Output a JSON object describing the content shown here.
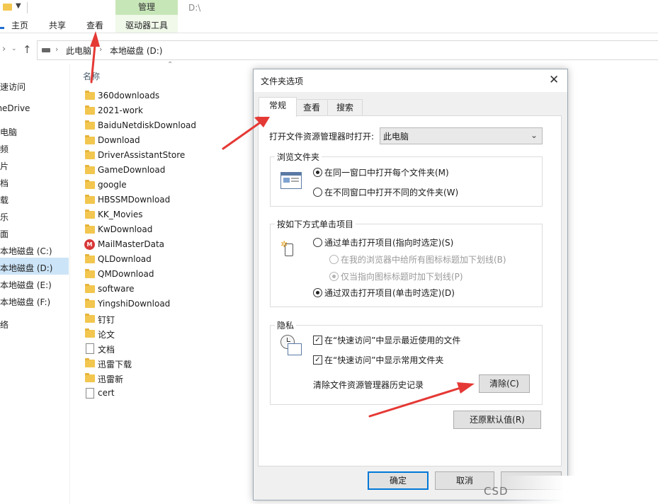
{
  "ribbon": {
    "manage_tab": "管理",
    "window_title": "D:\\",
    "tabs": [
      {
        "label": "主页"
      },
      {
        "label": "共享"
      },
      {
        "label": "查看"
      },
      {
        "label": "驱动器工具"
      }
    ]
  },
  "address": {
    "crumbs": [
      "此电脑",
      "本地磁盘 (D:)"
    ]
  },
  "nav_pane": {
    "items": [
      {
        "label": "快速访问"
      },
      {
        "label": "OneDrive"
      },
      {
        "label": "此电脑"
      },
      {
        "label": "视频"
      },
      {
        "label": "图片"
      },
      {
        "label": "文档"
      },
      {
        "label": "下载"
      },
      {
        "label": "音乐"
      },
      {
        "label": "桌面"
      },
      {
        "label": "本地磁盘 (C:)"
      },
      {
        "label": "本地磁盘 (D:)"
      },
      {
        "label": "本地磁盘 (E:)"
      },
      {
        "label": "本地磁盘 (F:)"
      },
      {
        "label": "网络"
      }
    ]
  },
  "file_list": {
    "column_name": "名称",
    "files": [
      {
        "name": "360downloads",
        "icon": "folder-icon"
      },
      {
        "name": "2021-work",
        "icon": "folder-icon"
      },
      {
        "name": "BaiduNetdiskDownload",
        "icon": "folder-icon"
      },
      {
        "name": "Download",
        "icon": "folder-icon"
      },
      {
        "name": "DriverAssistantStore",
        "icon": "folder-icon"
      },
      {
        "name": "GameDownload",
        "icon": "folder-icon"
      },
      {
        "name": "google",
        "icon": "folder-icon"
      },
      {
        "name": "HBSSMDownload",
        "icon": "folder-icon"
      },
      {
        "name": "KK_Movies",
        "icon": "folder-icon"
      },
      {
        "name": "KwDownload",
        "icon": "folder-icon"
      },
      {
        "name": "MailMasterData",
        "icon": "mailmaster-icon"
      },
      {
        "name": "QLDownload",
        "icon": "folder-icon"
      },
      {
        "name": "QMDownload",
        "icon": "folder-icon"
      },
      {
        "name": "software",
        "icon": "folder-icon"
      },
      {
        "name": "YingshiDownload",
        "icon": "folder-icon"
      },
      {
        "name": "钉钉",
        "icon": "folder-icon"
      },
      {
        "name": "论文",
        "icon": "folder-icon"
      },
      {
        "name": "文档",
        "icon": "document-icon"
      },
      {
        "name": "迅雷下载",
        "icon": "folder-icon"
      },
      {
        "name": "迅雷新",
        "icon": "folder-icon"
      },
      {
        "name": "cert",
        "icon": "file-icon"
      }
    ]
  },
  "dialog": {
    "title": "文件夹选项",
    "tabs": [
      "常规",
      "查看",
      "搜索"
    ],
    "open_explorer_label": "打开文件资源管理器时打开:",
    "open_explorer_value": "此电脑",
    "browse_group": {
      "label": "浏览文件夹",
      "options": [
        "在同一窗口中打开每个文件夹(M)",
        "在不同窗口中打开不同的文件夹(W)"
      ]
    },
    "click_group": {
      "label": "按如下方式单击项目",
      "single_click": "通过单击打开项目(指向时选定)(S)",
      "underline_browser": "在我的浏览器中给所有图标标题加下划线(B)",
      "underline_hover": "仅当指向图标标题时加下划线(P)",
      "double_click": "通过双击打开项目(单击时选定)(D)"
    },
    "privacy_group": {
      "label": "隐私",
      "recent_files": "在“快速访问”中显示最近使用的文件",
      "frequent_folders": "在“快速访问”中显示常用文件夹",
      "clear_history_label": "清除文件资源管理器历史记录",
      "clear_button": "清除(C)"
    },
    "restore_defaults": "还原默认值(R)",
    "ok": "确定",
    "cancel": "取消"
  },
  "watermark": "CSD",
  "colors": {
    "accent": "#0078d7",
    "manage_tab": "#c7e6b8",
    "arrow": "#e53935",
    "nav_selected": "#cce4f7"
  }
}
